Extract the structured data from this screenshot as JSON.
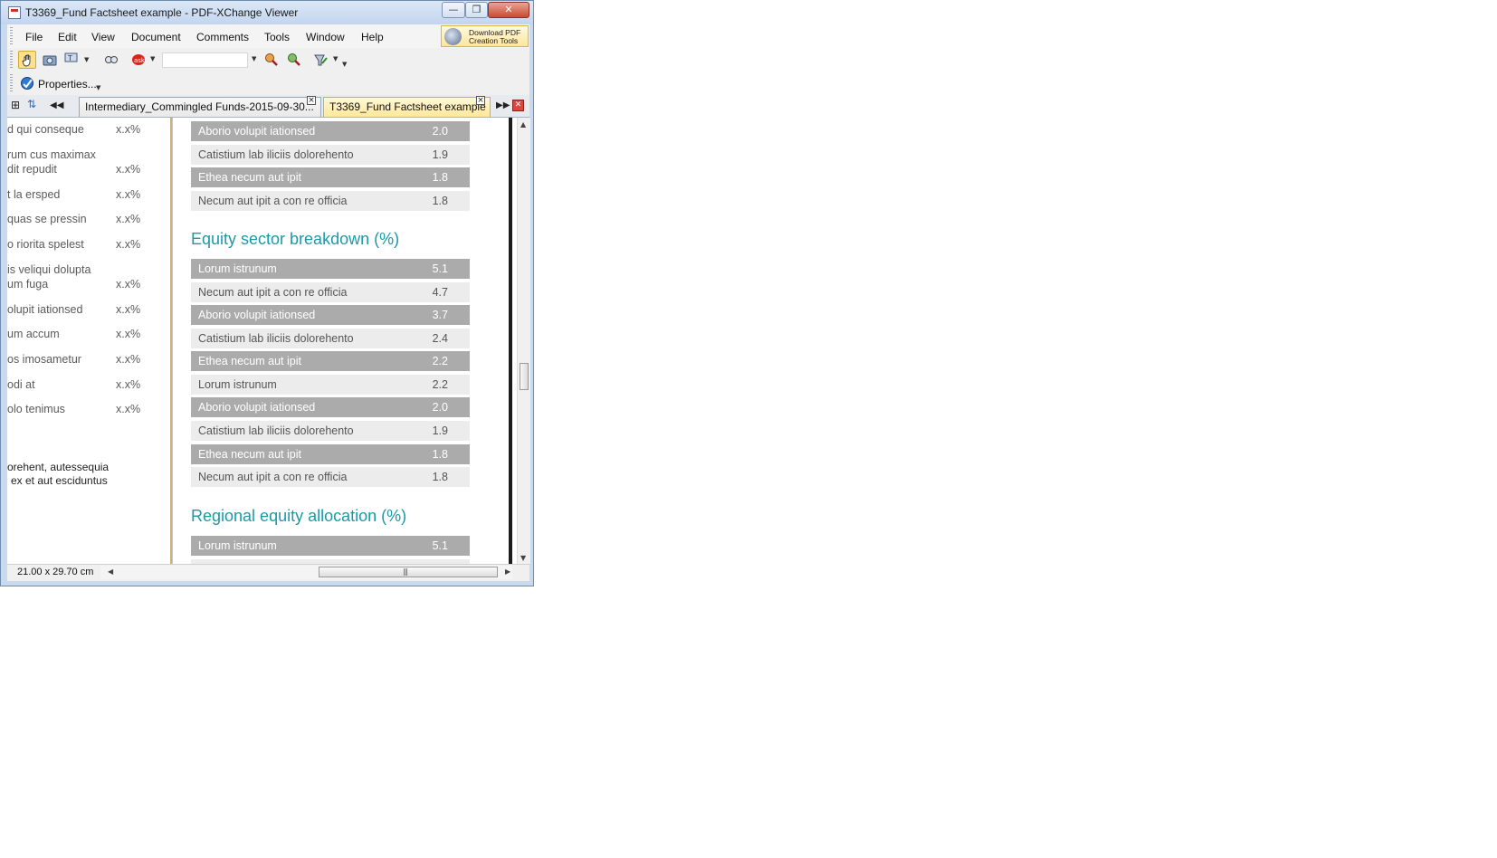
{
  "window": {
    "title": "T3369_Fund Factsheet example - PDF-XChange Viewer",
    "minimize_glyph": "—",
    "maximize_glyph": "❐",
    "close_glyph": "✕"
  },
  "menu": {
    "items": [
      "File",
      "Edit",
      "View",
      "Document",
      "Comments",
      "Tools",
      "Window",
      "Help"
    ],
    "download_label": "Download PDF Creation Tools"
  },
  "toolbar": {
    "icons": [
      "hand-tool-icon",
      "snapshot-icon",
      "select-text-icon",
      "find-icon",
      "search-icon",
      "zoom-in-icon",
      "zoom-out-icon",
      "highlight-icon"
    ],
    "zoom_value": ""
  },
  "toolbar2": {
    "properties_label": "Properties..."
  },
  "tabs": [
    {
      "label": "Intermediary_Commingled Funds-2015-09-30...",
      "active": false
    },
    {
      "label": "T3369_Fund Factsheet example",
      "active": true
    }
  ],
  "left_page": {
    "rows": [
      {
        "label": "d qui conseque",
        "value": "x.x%"
      },
      {
        "label": "rum cus maximax\ndit repudit",
        "value": "x.x%"
      },
      {
        "label": "t la ersped",
        "value": "x.x%"
      },
      {
        "label": "quas se pressin",
        "value": "x.x%"
      },
      {
        "label": "o riorita spelest",
        "value": "x.x%"
      },
      {
        "label": "is veliqui dolupta\num fuga",
        "value": "x.x%"
      },
      {
        "label": "olupit iationsed",
        "value": "x.x%"
      },
      {
        "label": "um accum",
        "value": "x.x%"
      },
      {
        "label": "os imosametur",
        "value": "x.x%"
      },
      {
        "label": "odi at",
        "value": "x.x%"
      },
      {
        "label": "olo tenimus",
        "value": "x.x%"
      }
    ],
    "note_line1": "orehent, autessequia",
    "note_line2": "ex et aut esciduntus"
  },
  "right_page": {
    "top_rows": [
      {
        "name": "Aborio volupit iationsed",
        "value": "2.0"
      },
      {
        "name": "Catistium lab iliciis dolorehento",
        "value": "1.9"
      },
      {
        "name": "Ethea necum aut ipit",
        "value": "1.8"
      },
      {
        "name": "Necum aut ipit a con re officia",
        "value": "1.8"
      }
    ],
    "equity_title": "Equity sector breakdown (%)",
    "equity_rows": [
      {
        "name": "Lorum istrunum",
        "value": "5.1"
      },
      {
        "name": "Necum aut ipit a con re officia",
        "value": "4.7"
      },
      {
        "name": "Aborio volupit iationsed",
        "value": "3.7"
      },
      {
        "name": "Catistium lab iliciis dolorehento",
        "value": "2.4"
      },
      {
        "name": "Ethea necum aut ipit",
        "value": "2.2"
      },
      {
        "name": "Lorum istrunum",
        "value": "2.2"
      },
      {
        "name": "Aborio volupit iationsed",
        "value": "2.0"
      },
      {
        "name": "Catistium lab iliciis dolorehento",
        "value": "1.9"
      },
      {
        "name": "Ethea necum aut ipit",
        "value": "1.8"
      },
      {
        "name": "Necum aut ipit a con re officia",
        "value": "1.8"
      }
    ],
    "regional_title": "Regional equity allocation (%)",
    "regional_rows": [
      {
        "name": "Lorum istrunum",
        "value": "5.1"
      }
    ]
  },
  "status": {
    "page_size": "21.00 x 29.70 cm"
  },
  "colors": {
    "accent_teal": "#1a9aa6",
    "row_dark": "#ababab",
    "row_light": "#ececec"
  }
}
